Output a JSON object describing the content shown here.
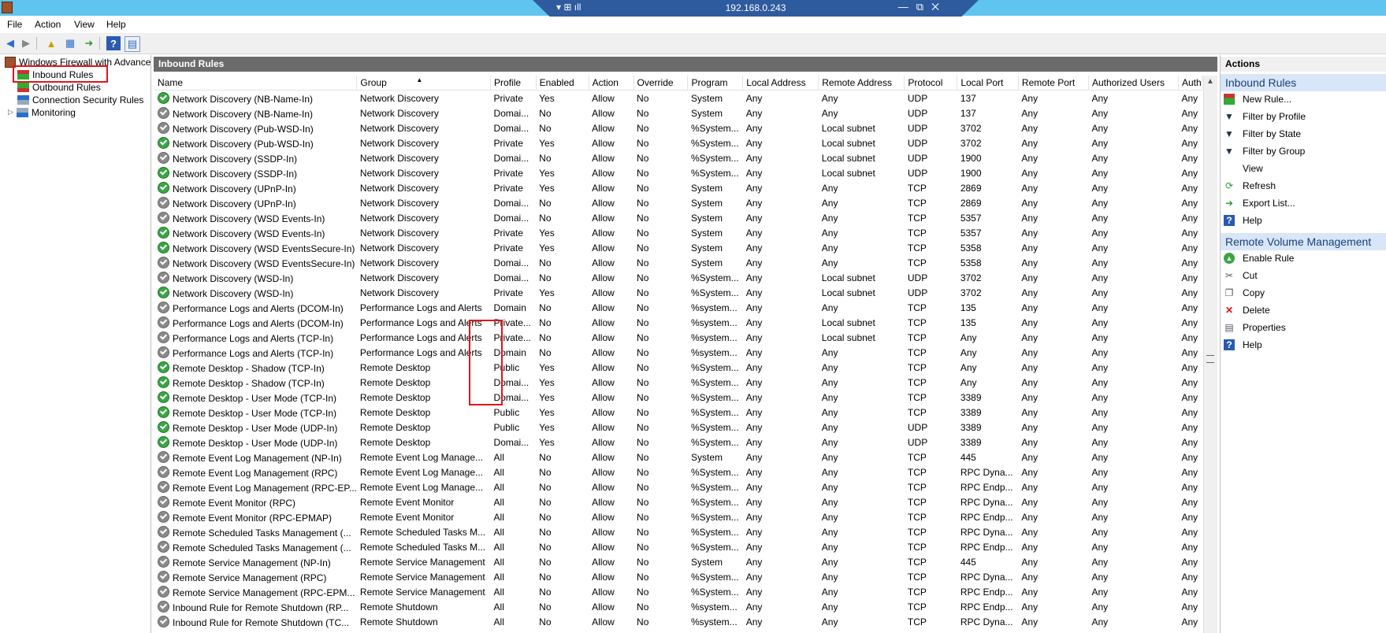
{
  "window": {
    "title": "192.168.0.243",
    "obscured_title": "Windows Firewall with Advanced Security"
  },
  "menu": [
    "File",
    "Action",
    "View",
    "Help"
  ],
  "tree": {
    "root": "Windows Firewall with Advance",
    "items": [
      "Inbound Rules",
      "Outbound Rules",
      "Connection Security Rules",
      "Monitoring"
    ]
  },
  "panel_title": "Inbound Rules",
  "columns": [
    "Name",
    "Group",
    "Profile",
    "Enabled",
    "Action",
    "Override",
    "Program",
    "Local Address",
    "Remote Address",
    "Protocol",
    "Local Port",
    "Remote Port",
    "Authorized Users",
    "Auth"
  ],
  "rules": [
    {
      "icon": "on",
      "cells": [
        "Network Discovery (NB-Name-In)",
        "Network Discovery",
        "Private",
        "Yes",
        "Allow",
        "No",
        "System",
        "Any",
        "Any",
        "UDP",
        "137",
        "Any",
        "Any",
        "Any"
      ]
    },
    {
      "icon": "off",
      "cells": [
        "Network Discovery (NB-Name-In)",
        "Network Discovery",
        "Domai...",
        "No",
        "Allow",
        "No",
        "System",
        "Any",
        "Any",
        "UDP",
        "137",
        "Any",
        "Any",
        "Any"
      ]
    },
    {
      "icon": "off",
      "cells": [
        "Network Discovery (Pub-WSD-In)",
        "Network Discovery",
        "Domai...",
        "No",
        "Allow",
        "No",
        "%System...",
        "Any",
        "Local subnet",
        "UDP",
        "3702",
        "Any",
        "Any",
        "Any"
      ]
    },
    {
      "icon": "on",
      "cells": [
        "Network Discovery (Pub-WSD-In)",
        "Network Discovery",
        "Private",
        "Yes",
        "Allow",
        "No",
        "%System...",
        "Any",
        "Local subnet",
        "UDP",
        "3702",
        "Any",
        "Any",
        "Any"
      ]
    },
    {
      "icon": "off",
      "cells": [
        "Network Discovery (SSDP-In)",
        "Network Discovery",
        "Domai...",
        "No",
        "Allow",
        "No",
        "%System...",
        "Any",
        "Local subnet",
        "UDP",
        "1900",
        "Any",
        "Any",
        "Any"
      ]
    },
    {
      "icon": "on",
      "cells": [
        "Network Discovery (SSDP-In)",
        "Network Discovery",
        "Private",
        "Yes",
        "Allow",
        "No",
        "%System...",
        "Any",
        "Local subnet",
        "UDP",
        "1900",
        "Any",
        "Any",
        "Any"
      ]
    },
    {
      "icon": "on",
      "cells": [
        "Network Discovery (UPnP-In)",
        "Network Discovery",
        "Private",
        "Yes",
        "Allow",
        "No",
        "System",
        "Any",
        "Any",
        "TCP",
        "2869",
        "Any",
        "Any",
        "Any"
      ]
    },
    {
      "icon": "off",
      "cells": [
        "Network Discovery (UPnP-In)",
        "Network Discovery",
        "Domai...",
        "No",
        "Allow",
        "No",
        "System",
        "Any",
        "Any",
        "TCP",
        "2869",
        "Any",
        "Any",
        "Any"
      ]
    },
    {
      "icon": "off",
      "cells": [
        "Network Discovery (WSD Events-In)",
        "Network Discovery",
        "Domai...",
        "No",
        "Allow",
        "No",
        "System",
        "Any",
        "Any",
        "TCP",
        "5357",
        "Any",
        "Any",
        "Any"
      ]
    },
    {
      "icon": "on",
      "cells": [
        "Network Discovery (WSD Events-In)",
        "Network Discovery",
        "Private",
        "Yes",
        "Allow",
        "No",
        "System",
        "Any",
        "Any",
        "TCP",
        "5357",
        "Any",
        "Any",
        "Any"
      ]
    },
    {
      "icon": "on",
      "cells": [
        "Network Discovery (WSD EventsSecure-In)",
        "Network Discovery",
        "Private",
        "Yes",
        "Allow",
        "No",
        "System",
        "Any",
        "Any",
        "TCP",
        "5358",
        "Any",
        "Any",
        "Any"
      ]
    },
    {
      "icon": "off",
      "cells": [
        "Network Discovery (WSD EventsSecure-In)",
        "Network Discovery",
        "Domai...",
        "No",
        "Allow",
        "No",
        "System",
        "Any",
        "Any",
        "TCP",
        "5358",
        "Any",
        "Any",
        "Any"
      ]
    },
    {
      "icon": "off",
      "cells": [
        "Network Discovery (WSD-In)",
        "Network Discovery",
        "Domai...",
        "No",
        "Allow",
        "No",
        "%System...",
        "Any",
        "Local subnet",
        "UDP",
        "3702",
        "Any",
        "Any",
        "Any"
      ]
    },
    {
      "icon": "on",
      "cells": [
        "Network Discovery (WSD-In)",
        "Network Discovery",
        "Private",
        "Yes",
        "Allow",
        "No",
        "%System...",
        "Any",
        "Local subnet",
        "UDP",
        "3702",
        "Any",
        "Any",
        "Any"
      ]
    },
    {
      "icon": "off",
      "cells": [
        "Performance Logs and Alerts (DCOM-In)",
        "Performance Logs and Alerts",
        "Domain",
        "No",
        "Allow",
        "No",
        "%system...",
        "Any",
        "Any",
        "TCP",
        "135",
        "Any",
        "Any",
        "Any"
      ]
    },
    {
      "icon": "off",
      "cells": [
        "Performance Logs and Alerts (DCOM-In)",
        "Performance Logs and Alerts",
        "Private...",
        "No",
        "Allow",
        "No",
        "%system...",
        "Any",
        "Local subnet",
        "TCP",
        "135",
        "Any",
        "Any",
        "Any"
      ]
    },
    {
      "icon": "off",
      "cells": [
        "Performance Logs and Alerts (TCP-In)",
        "Performance Logs and Alerts",
        "Private...",
        "No",
        "Allow",
        "No",
        "%system...",
        "Any",
        "Local subnet",
        "TCP",
        "Any",
        "Any",
        "Any",
        "Any"
      ]
    },
    {
      "icon": "off",
      "cells": [
        "Performance Logs and Alerts (TCP-In)",
        "Performance Logs and Alerts",
        "Domain",
        "No",
        "Allow",
        "No",
        "%system...",
        "Any",
        "Any",
        "TCP",
        "Any",
        "Any",
        "Any",
        "Any"
      ]
    },
    {
      "icon": "on",
      "cells": [
        "Remote Desktop - Shadow (TCP-In)",
        "Remote Desktop",
        "Public",
        "Yes",
        "Allow",
        "No",
        "%System...",
        "Any",
        "Any",
        "TCP",
        "Any",
        "Any",
        "Any",
        "Any"
      ]
    },
    {
      "icon": "on",
      "cells": [
        "Remote Desktop - Shadow (TCP-In)",
        "Remote Desktop",
        "Domai...",
        "Yes",
        "Allow",
        "No",
        "%System...",
        "Any",
        "Any",
        "TCP",
        "Any",
        "Any",
        "Any",
        "Any"
      ]
    },
    {
      "icon": "on",
      "cells": [
        "Remote Desktop - User Mode (TCP-In)",
        "Remote Desktop",
        "Domai...",
        "Yes",
        "Allow",
        "No",
        "%System...",
        "Any",
        "Any",
        "TCP",
        "3389",
        "Any",
        "Any",
        "Any"
      ]
    },
    {
      "icon": "on",
      "cells": [
        "Remote Desktop - User Mode (TCP-In)",
        "Remote Desktop",
        "Public",
        "Yes",
        "Allow",
        "No",
        "%System...",
        "Any",
        "Any",
        "TCP",
        "3389",
        "Any",
        "Any",
        "Any"
      ]
    },
    {
      "icon": "on",
      "cells": [
        "Remote Desktop - User Mode (UDP-In)",
        "Remote Desktop",
        "Public",
        "Yes",
        "Allow",
        "No",
        "%System...",
        "Any",
        "Any",
        "UDP",
        "3389",
        "Any",
        "Any",
        "Any"
      ]
    },
    {
      "icon": "on",
      "cells": [
        "Remote Desktop - User Mode (UDP-In)",
        "Remote Desktop",
        "Domai...",
        "Yes",
        "Allow",
        "No",
        "%System...",
        "Any",
        "Any",
        "UDP",
        "3389",
        "Any",
        "Any",
        "Any"
      ]
    },
    {
      "icon": "off",
      "cells": [
        "Remote Event Log Management (NP-In)",
        "Remote Event Log Manage...",
        "All",
        "No",
        "Allow",
        "No",
        "System",
        "Any",
        "Any",
        "TCP",
        "445",
        "Any",
        "Any",
        "Any"
      ]
    },
    {
      "icon": "off",
      "cells": [
        "Remote Event Log Management (RPC)",
        "Remote Event Log Manage...",
        "All",
        "No",
        "Allow",
        "No",
        "%System...",
        "Any",
        "Any",
        "TCP",
        "RPC Dyna...",
        "Any",
        "Any",
        "Any"
      ]
    },
    {
      "icon": "off",
      "cells": [
        "Remote Event Log Management (RPC-EP...",
        "Remote Event Log Manage...",
        "All",
        "No",
        "Allow",
        "No",
        "%System...",
        "Any",
        "Any",
        "TCP",
        "RPC Endp...",
        "Any",
        "Any",
        "Any"
      ]
    },
    {
      "icon": "off",
      "cells": [
        "Remote Event Monitor (RPC)",
        "Remote Event Monitor",
        "All",
        "No",
        "Allow",
        "No",
        "%System...",
        "Any",
        "Any",
        "TCP",
        "RPC Dyna...",
        "Any",
        "Any",
        "Any"
      ]
    },
    {
      "icon": "off",
      "cells": [
        "Remote Event Monitor (RPC-EPMAP)",
        "Remote Event Monitor",
        "All",
        "No",
        "Allow",
        "No",
        "%System...",
        "Any",
        "Any",
        "TCP",
        "RPC Endp...",
        "Any",
        "Any",
        "Any"
      ]
    },
    {
      "icon": "off",
      "cells": [
        "Remote Scheduled Tasks Management (...",
        "Remote Scheduled Tasks M...",
        "All",
        "No",
        "Allow",
        "No",
        "%System...",
        "Any",
        "Any",
        "TCP",
        "RPC Dyna...",
        "Any",
        "Any",
        "Any"
      ]
    },
    {
      "icon": "off",
      "cells": [
        "Remote Scheduled Tasks Management (...",
        "Remote Scheduled Tasks M...",
        "All",
        "No",
        "Allow",
        "No",
        "%System...",
        "Any",
        "Any",
        "TCP",
        "RPC Endp...",
        "Any",
        "Any",
        "Any"
      ]
    },
    {
      "icon": "off",
      "cells": [
        "Remote Service Management (NP-In)",
        "Remote Service Management",
        "All",
        "No",
        "Allow",
        "No",
        "System",
        "Any",
        "Any",
        "TCP",
        "445",
        "Any",
        "Any",
        "Any"
      ]
    },
    {
      "icon": "off",
      "cells": [
        "Remote Service Management (RPC)",
        "Remote Service Management",
        "All",
        "No",
        "Allow",
        "No",
        "%System...",
        "Any",
        "Any",
        "TCP",
        "RPC Dyna...",
        "Any",
        "Any",
        "Any"
      ]
    },
    {
      "icon": "off",
      "cells": [
        "Remote Service Management (RPC-EPM...",
        "Remote Service Management",
        "All",
        "No",
        "Allow",
        "No",
        "%System...",
        "Any",
        "Any",
        "TCP",
        "RPC Endp...",
        "Any",
        "Any",
        "Any"
      ]
    },
    {
      "icon": "off",
      "cells": [
        "Inbound Rule for Remote Shutdown (RP...",
        "Remote Shutdown",
        "All",
        "No",
        "Allow",
        "No",
        "%system...",
        "Any",
        "Any",
        "TCP",
        "RPC Endp...",
        "Any",
        "Any",
        "Any"
      ]
    },
    {
      "icon": "off",
      "cells": [
        "Inbound Rule for Remote Shutdown (TC...",
        "Remote Shutdown",
        "All",
        "No",
        "Allow",
        "No",
        "%system...",
        "Any",
        "Any",
        "TCP",
        "RPC Dyna...",
        "Any",
        "Any",
        "Any"
      ]
    }
  ],
  "actions": {
    "title": "Actions",
    "section1": "Inbound Rules",
    "section1_items": [
      "New Rule...",
      "Filter by Profile",
      "Filter by State",
      "Filter by Group",
      "View",
      "Refresh",
      "Export List...",
      "Help"
    ],
    "section2": "Remote Volume Management",
    "section2_items": [
      "Enable Rule",
      "Cut",
      "Copy",
      "Delete",
      "Properties",
      "Help"
    ]
  },
  "colors": {
    "titlebar": "#5fc4ee",
    "highlight": "#e0161b",
    "section_header": "#d8e6f7",
    "enabled_icon": "#3aa544",
    "disabled_icon": "#8a8a8a"
  }
}
